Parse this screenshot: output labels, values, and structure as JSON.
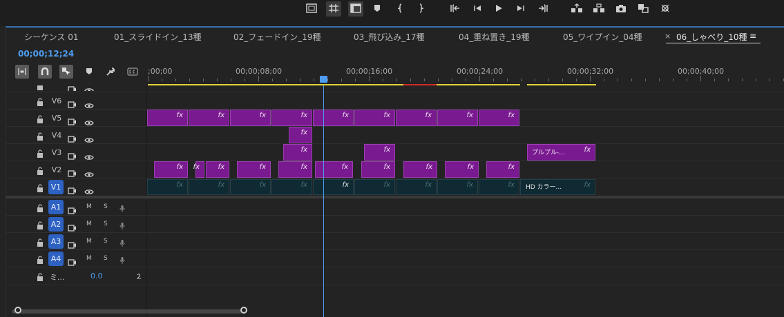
{
  "top_toolbar": {
    "icons": [
      "safe-margins-icon",
      "grid-icon",
      "overlay-icon",
      "marker-icon",
      "mark-in-icon",
      "mark-out-icon",
      "go-to-in-icon",
      "step-back-icon",
      "play-icon",
      "step-forward-icon",
      "go-to-out-icon",
      "lift-icon",
      "extract-icon",
      "export-frame-icon",
      "comparison-view-icon",
      "settings-icon"
    ]
  },
  "tabs": [
    {
      "label": "シーケンス 01"
    },
    {
      "label": "01_スライドイン_13種"
    },
    {
      "label": "02_フェードイン_19種"
    },
    {
      "label": "03_飛び込み_17種"
    },
    {
      "label": "04_重ね置き_19種"
    },
    {
      "label": "05_ワイプイン_04種"
    },
    {
      "label": "06_しゃべり_10種",
      "active": true
    }
  ],
  "tab_close_symbol": "×",
  "tab_menu_symbol": "≡",
  "timecode": "00;00;12;24",
  "ruler_labels": [
    ";00;00",
    "00;00;08;00",
    "00;00;16;00",
    "00;00;24;00",
    "00;00;32;00",
    "00;00;40;00"
  ],
  "video_tracks": [
    {
      "name": "V6"
    },
    {
      "name": "V5"
    },
    {
      "name": "V4"
    },
    {
      "name": "V3"
    },
    {
      "name": "V2"
    },
    {
      "name": "V1",
      "selected": true
    }
  ],
  "audio_tracks": [
    {
      "name": "A1",
      "m": "M",
      "s": "S"
    },
    {
      "name": "A2",
      "m": "M",
      "s": "S"
    },
    {
      "name": "A3",
      "m": "M",
      "s": "S"
    },
    {
      "name": "A4",
      "m": "M",
      "s": "S"
    }
  ],
  "mix_track": {
    "name": "ミ...",
    "value": "0.0"
  },
  "clips": {
    "fx_label": "fx",
    "v3_named": "プルプル-...",
    "v1_named": "HD カラー..."
  },
  "colors": {
    "accent": "#4d9cf0",
    "clip_purple": "#7a1a90",
    "clip_teal": "#0f2a33",
    "render_yellow": "#e2d33a",
    "render_red": "#d02a2a"
  }
}
